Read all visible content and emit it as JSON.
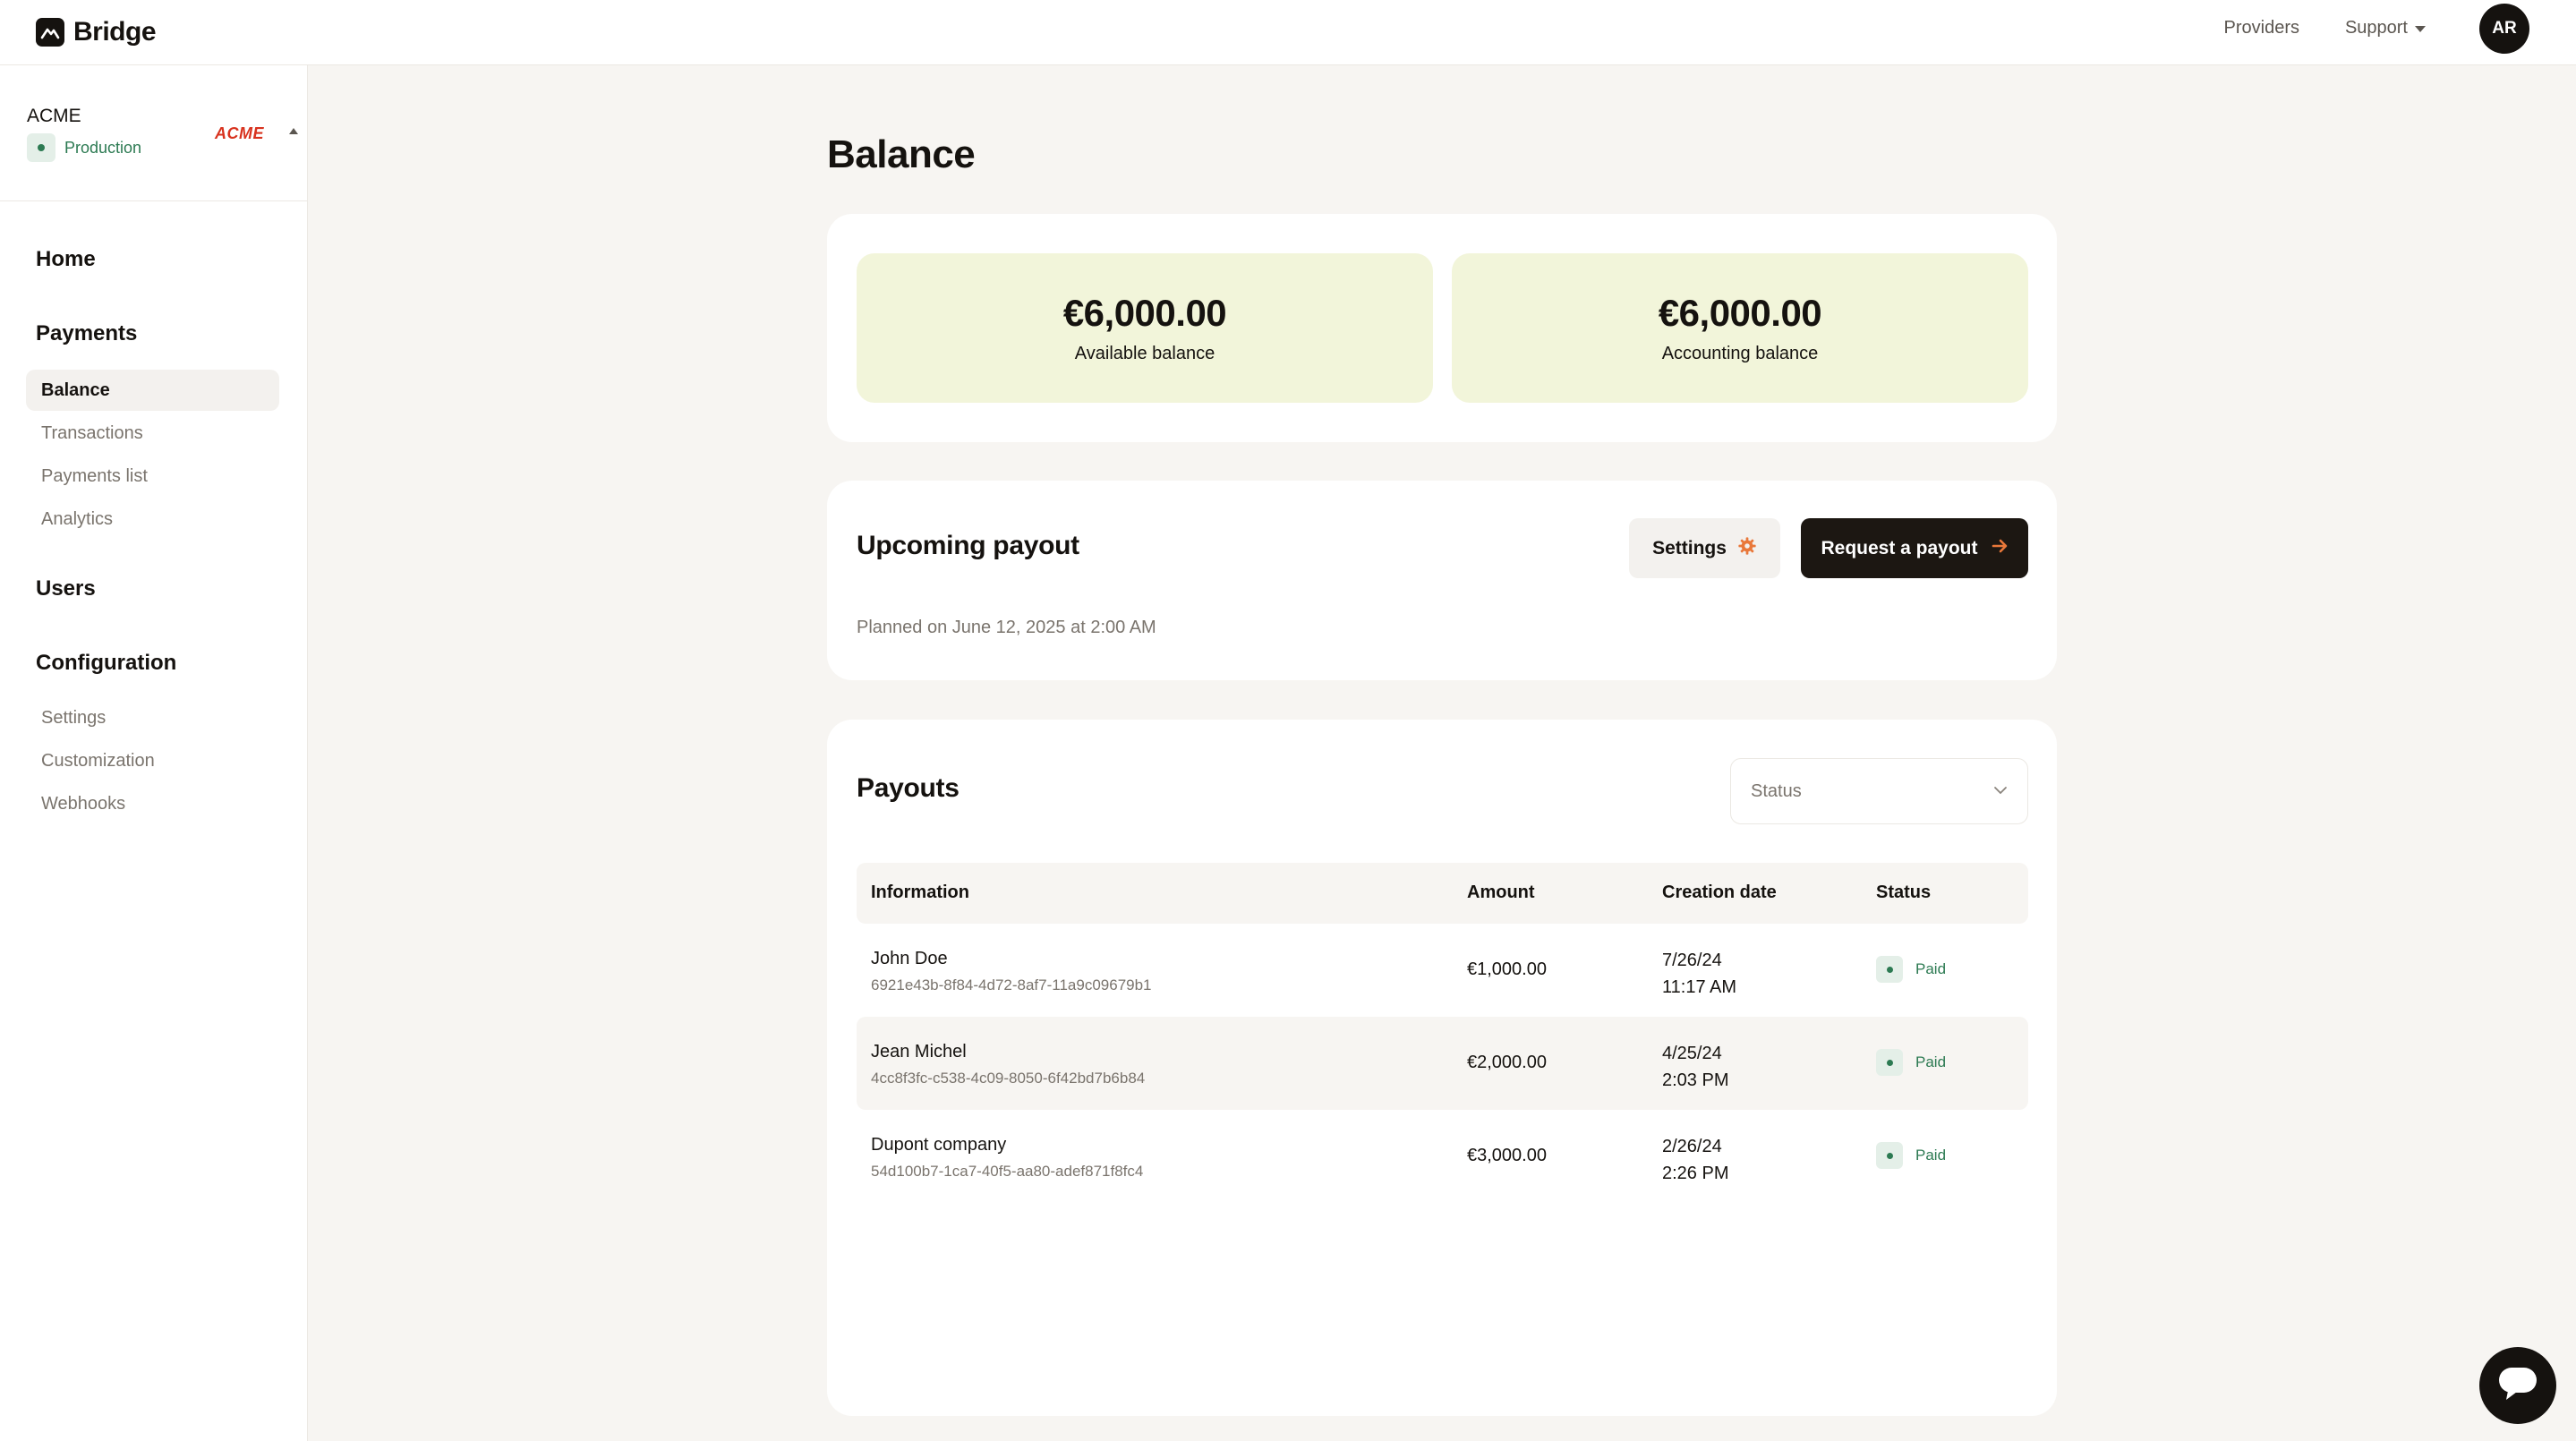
{
  "app": {
    "name": "Bridge",
    "logo_icon": "bridge-logo-icon"
  },
  "topbar": {
    "providers_label": "Providers",
    "support_label": "Support",
    "avatar_initials": "AR"
  },
  "sidebar": {
    "org": {
      "name": "ACME",
      "environment": "Production",
      "logo_text": "ACME"
    },
    "sections": {
      "home": "Home",
      "payments": "Payments",
      "users": "Users",
      "configuration": "Configuration"
    },
    "payments_items": [
      "Balance",
      "Transactions",
      "Payments list",
      "Analytics"
    ],
    "configuration_items": [
      "Settings",
      "Customization",
      "Webhooks"
    ],
    "active_item": "Balance"
  },
  "main": {
    "title": "Balance",
    "balances": [
      {
        "amount": "€6,000.00",
        "label": "Available balance"
      },
      {
        "amount": "€6,000.00",
        "label": "Accounting balance"
      }
    ],
    "upcoming": {
      "title": "Upcoming payout",
      "planned": "Planned on June 12, 2025 at 2:00 AM",
      "settings_label": "Settings",
      "request_label": "Request a payout"
    },
    "payouts": {
      "title": "Payouts",
      "status_placeholder": "Status",
      "columns": [
        "Information",
        "Amount",
        "Creation date",
        "Status"
      ],
      "rows": [
        {
          "name": "John Doe",
          "id": "6921e43b-8f84-4d72-8af7-11a9c09679b1",
          "amount": "€1,000.00",
          "date": "7/26/24",
          "time": "11:17 AM",
          "status": "Paid"
        },
        {
          "name": "Jean Michel",
          "id": "4cc8f3fc-c538-4c09-8050-6f42bd7b6b84",
          "amount": "€2,000.00",
          "date": "4/25/24",
          "time": "2:03 PM",
          "status": "Paid"
        },
        {
          "name": "Dupont company",
          "id": "54d100b7-1ca7-40f5-aa80-adef871f8fc4",
          "amount": "€3,000.00",
          "date": "2/26/24",
          "time": "2:26 PM",
          "status": "Paid"
        }
      ]
    }
  },
  "colors": {
    "accent": "#e9783a",
    "dark": "#15120f",
    "balance_tile": "#f2f5da",
    "success": "#2c7a52"
  }
}
